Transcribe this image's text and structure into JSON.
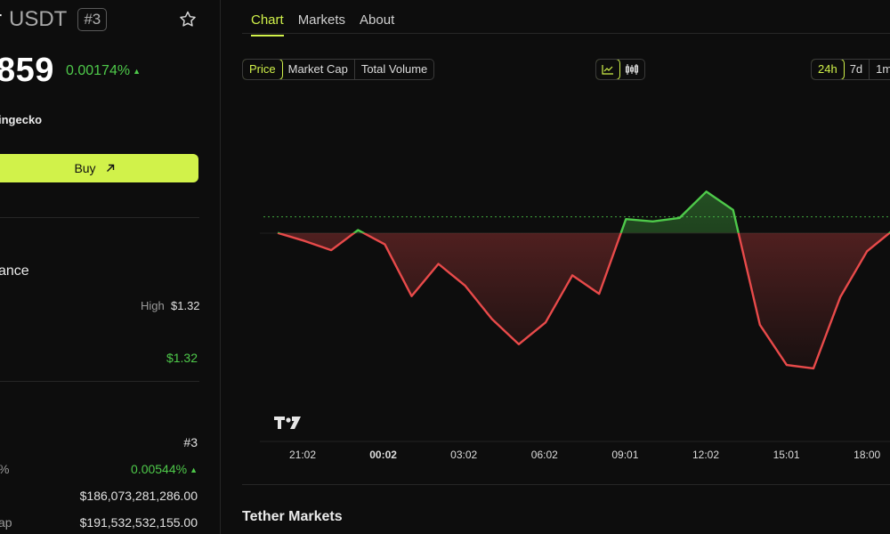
{
  "coin": {
    "name_fragment": "r",
    "symbol": "USDT",
    "rank": "#3",
    "price": "859",
    "change_pct": "0.00174%",
    "source": "ingecko",
    "buy_label": "Buy"
  },
  "perf": {
    "heading_fragment": "ance",
    "high_label": "High",
    "high_value": "$1.32",
    "green_value": "$1.32"
  },
  "stats": {
    "rank_value": "#3",
    "pct_label_fragment": "%",
    "pct_value": "0.00544%",
    "market_cap_value": "$186,073,281,286.00",
    "fdv_label_fragment": "ap",
    "fdv_value": "$191,532,532,155.00"
  },
  "tabs": [
    "Chart",
    "Markets",
    "About"
  ],
  "metric_options": [
    "Price",
    "Market Cap",
    "Total Volume"
  ],
  "range_options": [
    "24h",
    "7d",
    "1m"
  ],
  "markets_title": "Tether Markets",
  "colors": {
    "accent": "#d1f24a",
    "up": "#4ec94a",
    "down": "#e84a4a"
  },
  "chart_data": {
    "type": "line",
    "x_labels": [
      "21:02",
      "00:02",
      "03:02",
      "06:02",
      "09:01",
      "12:02",
      "15:01",
      "18:00"
    ],
    "bold_label": "00:02",
    "baseline_index": 0,
    "values": [
      0.1,
      -0.6,
      -1.4,
      0.35,
      -0.9,
      -5.4,
      -2.6,
      -4.5,
      -7.4,
      -9.6,
      -7.7,
      -3.6,
      -5.2,
      1.3,
      1.1,
      1.4,
      3.7,
      2.1,
      -7.9,
      -11.4,
      -11.7,
      -5.5,
      -1.5,
      0.4
    ],
    "reference_line": 1.5
  }
}
